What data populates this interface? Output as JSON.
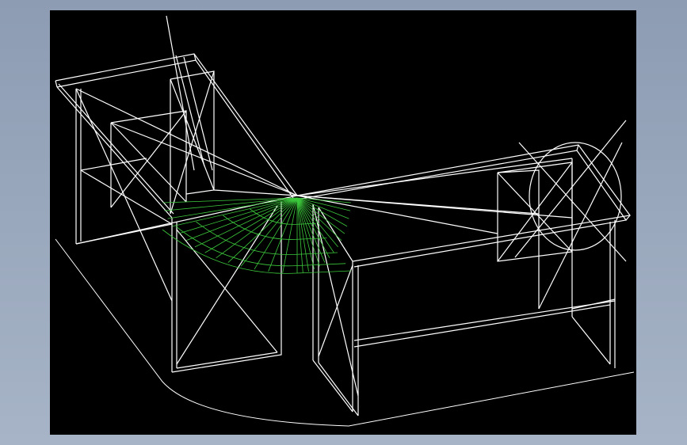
{
  "viewport": {
    "background": "#000000",
    "line_color": "#ffffff",
    "accent_color": "#3cc83c",
    "content": "wireframe-corner-desk"
  }
}
